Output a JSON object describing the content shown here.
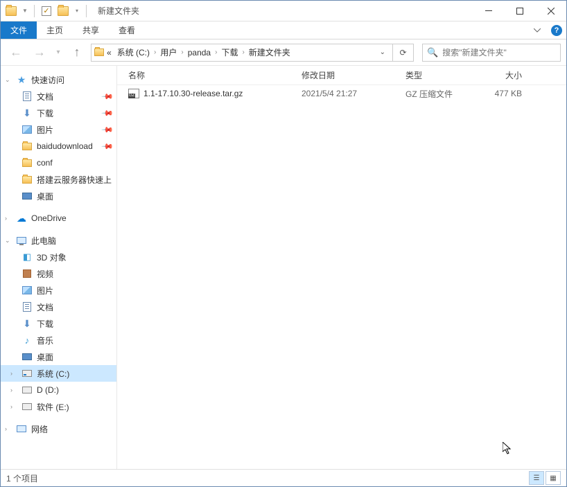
{
  "title": "新建文件夹",
  "ribbon": {
    "file": "文件",
    "home": "主页",
    "share": "共享",
    "view": "查看"
  },
  "breadcrumb": {
    "prefix": "«",
    "parts": [
      "系统 (C:)",
      "用户",
      "panda",
      "下载",
      "新建文件夹"
    ]
  },
  "search_placeholder": "搜索\"新建文件夹\"",
  "columns": {
    "name": "名称",
    "date": "修改日期",
    "type": "类型",
    "size": "大小"
  },
  "files": [
    {
      "name": "1.1-17.10.30-release.tar.gz",
      "date": "2021/5/4 21:27",
      "type": "GZ 压缩文件",
      "size": "477 KB"
    }
  ],
  "sidebar": {
    "quick_access": "快速访问",
    "quick_items": [
      {
        "label": "文档",
        "pin": true
      },
      {
        "label": "下载",
        "pin": true
      },
      {
        "label": "图片",
        "pin": true
      },
      {
        "label": "baidudownload",
        "pin": true
      },
      {
        "label": "conf"
      },
      {
        "label": "搭建云服务器快速上"
      },
      {
        "label": "桌面"
      }
    ],
    "onedrive": "OneDrive",
    "thispc": "此电脑",
    "thispc_items": [
      {
        "label": "3D 对象"
      },
      {
        "label": "视频"
      },
      {
        "label": "图片"
      },
      {
        "label": "文档"
      },
      {
        "label": "下载"
      },
      {
        "label": "音乐"
      },
      {
        "label": "桌面"
      },
      {
        "label": "系统 (C:)",
        "selected": true
      },
      {
        "label": "D (D:)"
      },
      {
        "label": "软件 (E:)"
      }
    ],
    "network": "网络"
  },
  "status": "1 个项目"
}
